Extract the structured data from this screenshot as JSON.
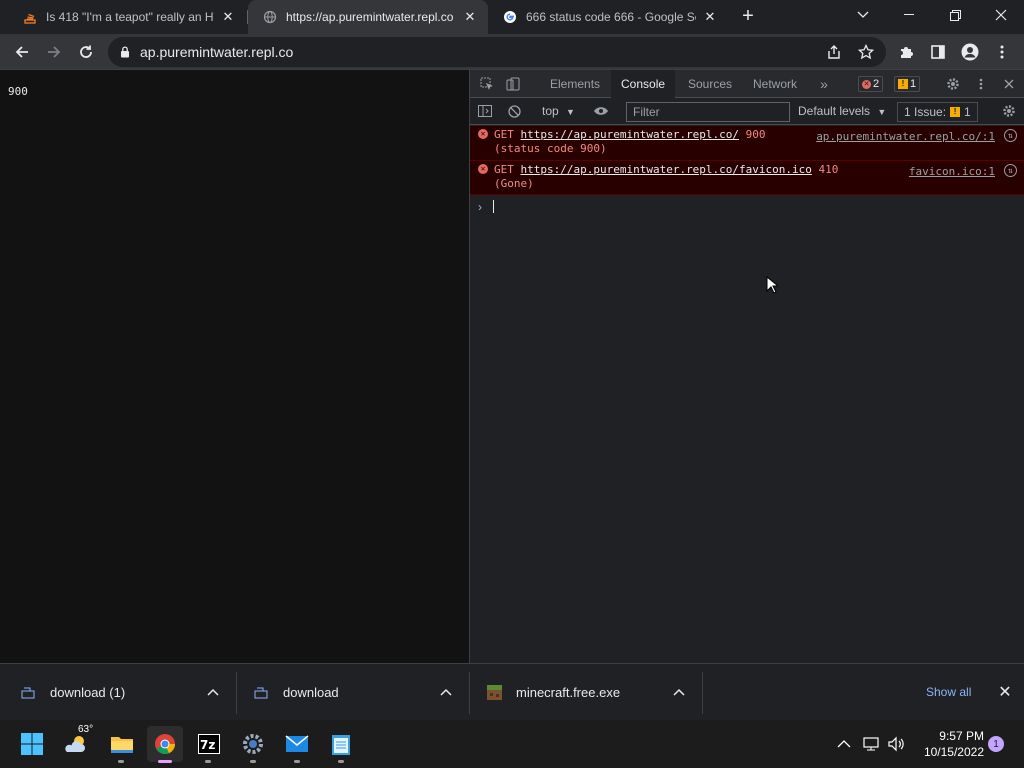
{
  "browser": {
    "tabs": [
      {
        "title": "Is 418 \"I'm a teapot\" really an HT",
        "favicon": "stackoverflow-icon",
        "active": false
      },
      {
        "title": "https://ap.puremintwater.repl.co",
        "favicon": "globe-icon",
        "active": true
      },
      {
        "title": "666 status code 666 - Google Se",
        "favicon": "google-icon",
        "active": false
      }
    ],
    "address": "ap.puremintwater.repl.co"
  },
  "page": {
    "body_text": "900"
  },
  "devtools": {
    "tabs": [
      "Elements",
      "Console",
      "Sources",
      "Network"
    ],
    "active_tab": "Console",
    "error_count": "2",
    "warning_count": "1",
    "context": "top",
    "filter_placeholder": "Filter",
    "levels": "Default levels",
    "issues_label": "1 Issue:",
    "issues_count": "1",
    "messages": [
      {
        "method": "GET",
        "url": "https://ap.puremintwater.repl.co/",
        "code": "900",
        "status": "(status code 900)",
        "source": "ap.puremintwater.repl.co/:1"
      },
      {
        "method": "GET",
        "url": "https://ap.puremintwater.repl.co/favicon.ico",
        "code": "410",
        "status": "(Gone)",
        "source": "favicon.ico:1"
      }
    ],
    "prompt": "›"
  },
  "downloads": {
    "items": [
      {
        "name": "download (1)",
        "icon": "file-icon"
      },
      {
        "name": "download",
        "icon": "file-icon"
      },
      {
        "name": "minecraft.free.exe",
        "icon": "minecraft-icon"
      }
    ],
    "show_all": "Show all"
  },
  "taskbar": {
    "temperature": "63°",
    "time": "9:57 PM",
    "date": "10/15/2022",
    "notifications": "1"
  },
  "colors": {
    "error_bg": "#290000",
    "error_text": "#f28b82",
    "link": "#8ab4f8"
  }
}
